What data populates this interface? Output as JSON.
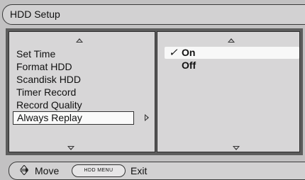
{
  "title": "HDD Setup",
  "menu": {
    "items": [
      "Set Time",
      "Format HDD",
      "Scandisk HDD",
      "Timer Record",
      "Record Quality",
      "Always Replay"
    ],
    "selected_index": 5
  },
  "options": {
    "items": [
      "On",
      "Off"
    ],
    "checked_index": 0,
    "check_mark": "✓"
  },
  "footer": {
    "move_label": "Move",
    "key_label": "HDD MENU",
    "exit_label": "Exit"
  },
  "icons": {
    "nav": "up-down-navigation-icon",
    "scroll_up": "scroll-up-arrow-icon",
    "scroll_down": "scroll-down-arrow-icon",
    "submenu": "submenu-right-arrow-icon"
  }
}
